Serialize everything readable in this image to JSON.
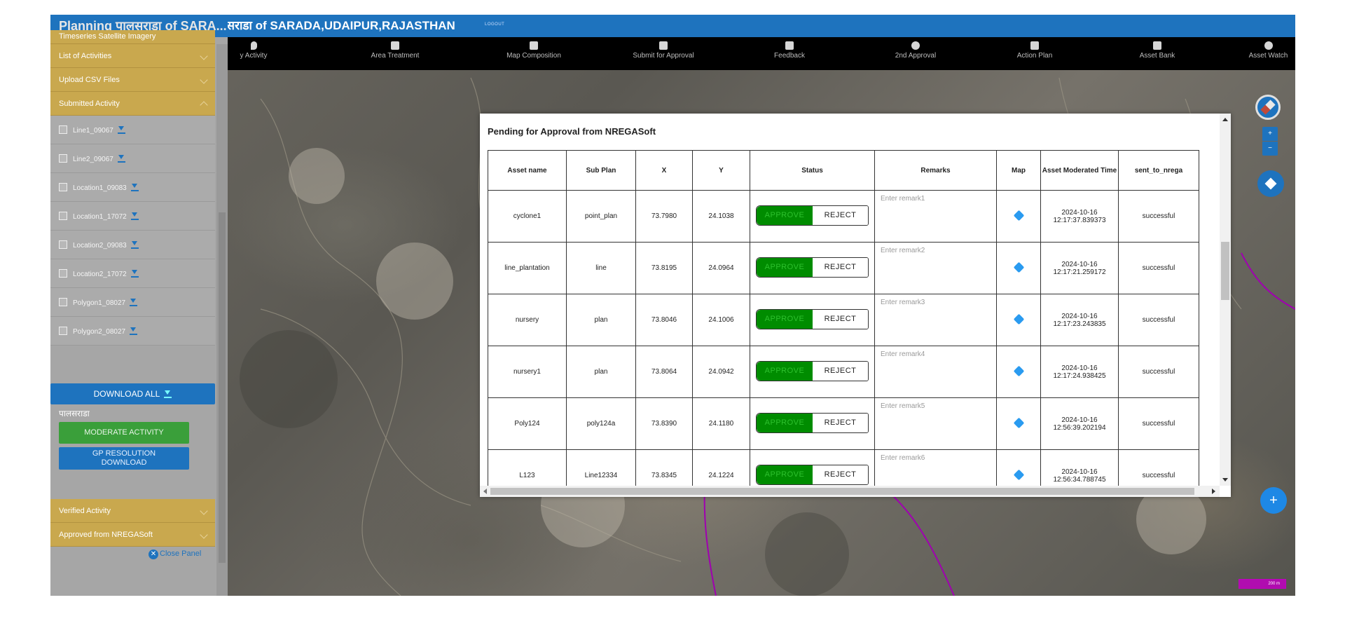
{
  "header": {
    "sidebar_title": "Planning पालसराडा of SARA...",
    "app_title": "लसराडा of SARADA,UDAIPUR,RAJASTHAN",
    "logout": "LOGOUT"
  },
  "menubar": {
    "items": [
      {
        "label": "y Activity",
        "icon": "location-icon"
      },
      {
        "label": "Area Treatment",
        "icon": "area-icon"
      },
      {
        "label": "Map Composition",
        "icon": "map-icon"
      },
      {
        "label": "Submit for Approval",
        "icon": "upload-icon"
      },
      {
        "label": "Feedback",
        "icon": "feedback-icon"
      },
      {
        "label": "2nd Approval",
        "icon": "check-circle-icon"
      },
      {
        "label": "Action Plan",
        "icon": "save-icon"
      },
      {
        "label": "Asset Bank",
        "icon": "bank-icon"
      },
      {
        "label": "Asset Watch",
        "icon": "eye-icon"
      }
    ]
  },
  "sidebar": {
    "sections_top": [
      {
        "label": "Timeseries Satellite Imagery"
      },
      {
        "label": "List of Activities"
      },
      {
        "label": "Upload CSV Files"
      },
      {
        "label": "Submitted Activity"
      }
    ],
    "files": [
      {
        "name": "Line1_09067"
      },
      {
        "name": "Line2_09067"
      },
      {
        "name": "Location1_09083"
      },
      {
        "name": "Location1_17072"
      },
      {
        "name": "Location2_09083"
      },
      {
        "name": "Location2_17072"
      },
      {
        "name": "Polygon1_08027"
      },
      {
        "name": "Polygon2_08027"
      }
    ],
    "download_all": "DOWNLOAD ALL",
    "gp_label": "पालसराडा",
    "moderate_activity": "MODERATE ACTIVITY",
    "gp_resolution_download_line1": "GP RESOLUTION",
    "gp_resolution_download_line2": "DOWNLOAD",
    "sections_bottom": [
      {
        "label": "Verified Activity"
      },
      {
        "label": "Approved from NREGASoft"
      }
    ],
    "close_panel": "Close Panel"
  },
  "modal": {
    "title": "Pending for Approval from NREGASoft",
    "columns": [
      "Asset name",
      "Sub Plan",
      "X",
      "Y",
      "Status",
      "Remarks",
      "Map",
      "Asset Moderated Time",
      "sent_to_nrega"
    ],
    "approve_label": "APPROVE",
    "reject_label": "REJECT",
    "rows": [
      {
        "asset_name": "cyclone1",
        "sub_plan": "point_plan",
        "x": "73.7980",
        "y": "24.1038",
        "remark_placeholder": "Enter remark1",
        "time_date": "2024-10-16",
        "time_clock": "12:17:37.839373",
        "sent": "successful"
      },
      {
        "asset_name": "line_plantation",
        "sub_plan": "line",
        "x": "73.8195",
        "y": "24.0964",
        "remark_placeholder": "Enter remark2",
        "time_date": "2024-10-16",
        "time_clock": "12:17:21.259172",
        "sent": "successful"
      },
      {
        "asset_name": "nursery",
        "sub_plan": "plan",
        "x": "73.8046",
        "y": "24.1006",
        "remark_placeholder": "Enter remark3",
        "time_date": "2024-10-16",
        "time_clock": "12:17:23.243835",
        "sent": "successful"
      },
      {
        "asset_name": "nursery1",
        "sub_plan": "plan",
        "x": "73.8064",
        "y": "24.0942",
        "remark_placeholder": "Enter remark4",
        "time_date": "2024-10-16",
        "time_clock": "12:17:24.938425",
        "sent": "successful"
      },
      {
        "asset_name": "Poly124",
        "sub_plan": "poly124a",
        "x": "73.8390",
        "y": "24.1180",
        "remark_placeholder": "Enter remark5",
        "time_date": "2024-10-16",
        "time_clock": "12:56:39.202194",
        "sent": "successful"
      },
      {
        "asset_name": "L123",
        "sub_plan": "Line12334",
        "x": "73.8345",
        "y": "24.1224",
        "remark_placeholder": "Enter remark6",
        "time_date": "2024-10-16",
        "time_clock": "12:56:34.788745",
        "sent": "successful"
      }
    ]
  },
  "map": {
    "zoom_in": "+",
    "zoom_out": "−",
    "add": "+",
    "scale_label": "200 m"
  },
  "colors": {
    "primary": "#1e73be",
    "accordion": "#c9a84e",
    "approve": "#008c00",
    "boundary": "#a000b0"
  }
}
